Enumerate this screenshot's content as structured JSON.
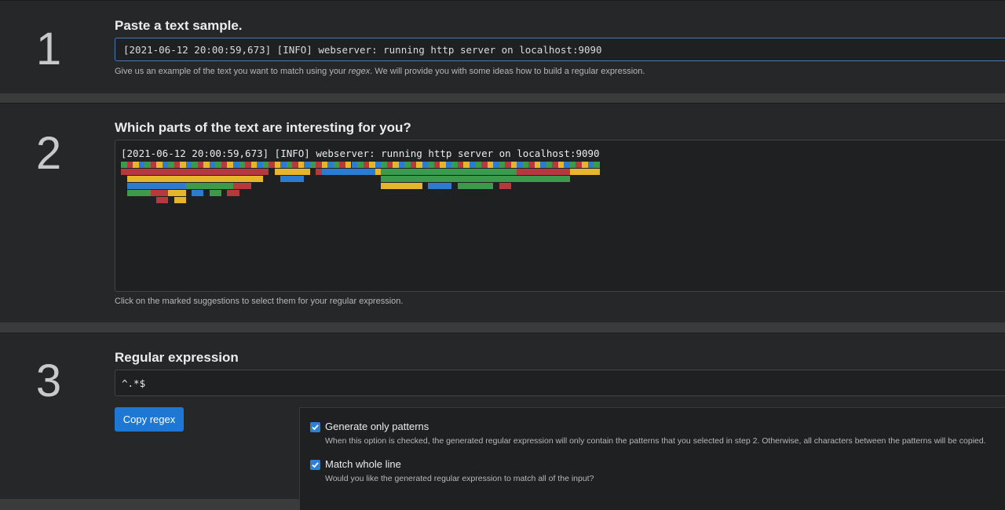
{
  "step1": {
    "number": "1",
    "title": "Paste a text sample.",
    "sample_value": "[2021-06-12 20:00:59,673] [INFO] webserver: running http server on localhost:9090",
    "help_before": "Give us an example of the text you want to match using your ",
    "help_em": "regex",
    "help_after": ". We will provide you with some ideas how to build a regular expression."
  },
  "step2": {
    "number": "2",
    "title": "Which parts of the text are interesting for you?",
    "sample_text": "[2021-06-12 20:00:59,673] [INFO] webserver: running http server on localhost:9090",
    "help": "Click on the marked suggestions to select them for your regular expression.",
    "colors": {
      "red": "#b5393d",
      "yellow": "#e5b62c",
      "green": "#3c9a4d",
      "blue": "#2b7bd1"
    },
    "suggestion_rows": [
      [
        [
          0,
          1,
          "green"
        ],
        [
          1,
          2,
          "red"
        ],
        [
          2,
          3,
          "yellow"
        ],
        [
          3,
          4,
          "blue"
        ],
        [
          4,
          5,
          "green"
        ],
        [
          5,
          6,
          "red"
        ],
        [
          6,
          7,
          "yellow"
        ],
        [
          7,
          8,
          "blue"
        ],
        [
          8,
          9,
          "green"
        ],
        [
          9,
          10,
          "red"
        ],
        [
          10,
          11,
          "yellow"
        ],
        [
          11,
          12,
          "blue"
        ],
        [
          12,
          13,
          "green"
        ],
        [
          13,
          14,
          "red"
        ],
        [
          14,
          15,
          "yellow"
        ],
        [
          15,
          16,
          "blue"
        ],
        [
          16,
          17,
          "green"
        ],
        [
          17,
          18,
          "red"
        ],
        [
          18,
          19,
          "yellow"
        ],
        [
          19,
          20,
          "blue"
        ],
        [
          20,
          21,
          "green"
        ],
        [
          21,
          22,
          "red"
        ],
        [
          22,
          23,
          "yellow"
        ],
        [
          23,
          24,
          "blue"
        ],
        [
          24,
          25,
          "green"
        ],
        [
          25,
          26,
          "red"
        ],
        [
          26,
          27,
          "yellow"
        ],
        [
          27,
          28,
          "blue"
        ],
        [
          28,
          29,
          "green"
        ],
        [
          29,
          30,
          "red"
        ],
        [
          30,
          31,
          "yellow"
        ],
        [
          31,
          32,
          "blue"
        ],
        [
          32,
          33,
          "green"
        ],
        [
          33,
          34,
          "red"
        ],
        [
          34,
          35,
          "yellow"
        ],
        [
          35,
          36,
          "blue"
        ],
        [
          36,
          37,
          "green"
        ],
        [
          37,
          38,
          "red"
        ],
        [
          38,
          39,
          "yellow"
        ],
        [
          39,
          40,
          "blue"
        ],
        [
          40,
          41,
          "green"
        ],
        [
          41,
          42,
          "red"
        ],
        [
          42,
          43,
          "yellow"
        ],
        [
          43,
          44,
          "blue"
        ],
        [
          44,
          45,
          "green"
        ],
        [
          45,
          46,
          "red"
        ],
        [
          46,
          47,
          "yellow"
        ],
        [
          47,
          48,
          "blue"
        ],
        [
          48,
          49,
          "green"
        ],
        [
          49,
          50,
          "red"
        ],
        [
          50,
          51,
          "yellow"
        ],
        [
          51,
          52,
          "blue"
        ],
        [
          52,
          53,
          "green"
        ],
        [
          53,
          54,
          "red"
        ],
        [
          54,
          55,
          "yellow"
        ],
        [
          55,
          56,
          "blue"
        ],
        [
          56,
          57,
          "green"
        ],
        [
          57,
          58,
          "red"
        ],
        [
          58,
          59,
          "yellow"
        ],
        [
          59,
          60,
          "blue"
        ],
        [
          60,
          61,
          "green"
        ],
        [
          61,
          62,
          "red"
        ],
        [
          62,
          63,
          "yellow"
        ],
        [
          63,
          64,
          "blue"
        ],
        [
          64,
          65,
          "green"
        ],
        [
          65,
          66,
          "red"
        ],
        [
          66,
          67,
          "yellow"
        ],
        [
          67,
          68,
          "blue"
        ],
        [
          68,
          69,
          "green"
        ],
        [
          69,
          70,
          "red"
        ],
        [
          70,
          71,
          "yellow"
        ],
        [
          71,
          72,
          "blue"
        ],
        [
          72,
          73,
          "green"
        ],
        [
          73,
          74,
          "red"
        ],
        [
          74,
          75,
          "yellow"
        ],
        [
          75,
          76,
          "blue"
        ],
        [
          76,
          77,
          "green"
        ],
        [
          77,
          78,
          "red"
        ],
        [
          78,
          79,
          "yellow"
        ],
        [
          79,
          80,
          "blue"
        ],
        [
          80,
          81,
          "green"
        ]
      ],
      [
        [
          0,
          25,
          "red"
        ],
        [
          26,
          32,
          "yellow"
        ],
        [
          33,
          34,
          "red"
        ],
        [
          34,
          43,
          "blue"
        ],
        [
          43,
          44,
          "yellow"
        ],
        [
          44,
          67,
          "green"
        ],
        [
          67,
          76,
          "red"
        ],
        [
          76,
          77,
          "yellow"
        ],
        [
          77,
          81,
          "yellow"
        ]
      ],
      [
        [
          1,
          24,
          "yellow"
        ],
        [
          27,
          31,
          "blue"
        ],
        [
          44,
          76,
          "green"
        ]
      ],
      [
        [
          1,
          11,
          "blue"
        ],
        [
          11,
          19,
          "green"
        ],
        [
          19,
          22,
          "red"
        ],
        [
          44,
          51,
          "yellow"
        ],
        [
          52,
          56,
          "blue"
        ],
        [
          57,
          63,
          "green"
        ],
        [
          64,
          66,
          "red"
        ]
      ],
      [
        [
          1,
          5,
          "green"
        ],
        [
          5,
          8,
          "red"
        ],
        [
          8,
          11,
          "yellow"
        ],
        [
          12,
          14,
          "blue"
        ],
        [
          15,
          17,
          "green"
        ],
        [
          18,
          20,
          "red"
        ]
      ],
      [
        [
          6,
          8,
          "red"
        ],
        [
          9,
          11,
          "yellow"
        ]
      ]
    ]
  },
  "step3": {
    "number": "3",
    "title": "Regular expression",
    "regex": "^.*$",
    "copy_label": "Copy regex",
    "options": [
      {
        "label": "Generate only patterns",
        "description": "When this option is checked, the generated regular expression will only contain the patterns that you selected in step 2. Otherwise, all characters between the patterns will be copied.",
        "checked": true
      },
      {
        "label": "Match whole line",
        "description": "Would you like the generated regular expression to match all of the input?",
        "checked": true
      }
    ]
  }
}
